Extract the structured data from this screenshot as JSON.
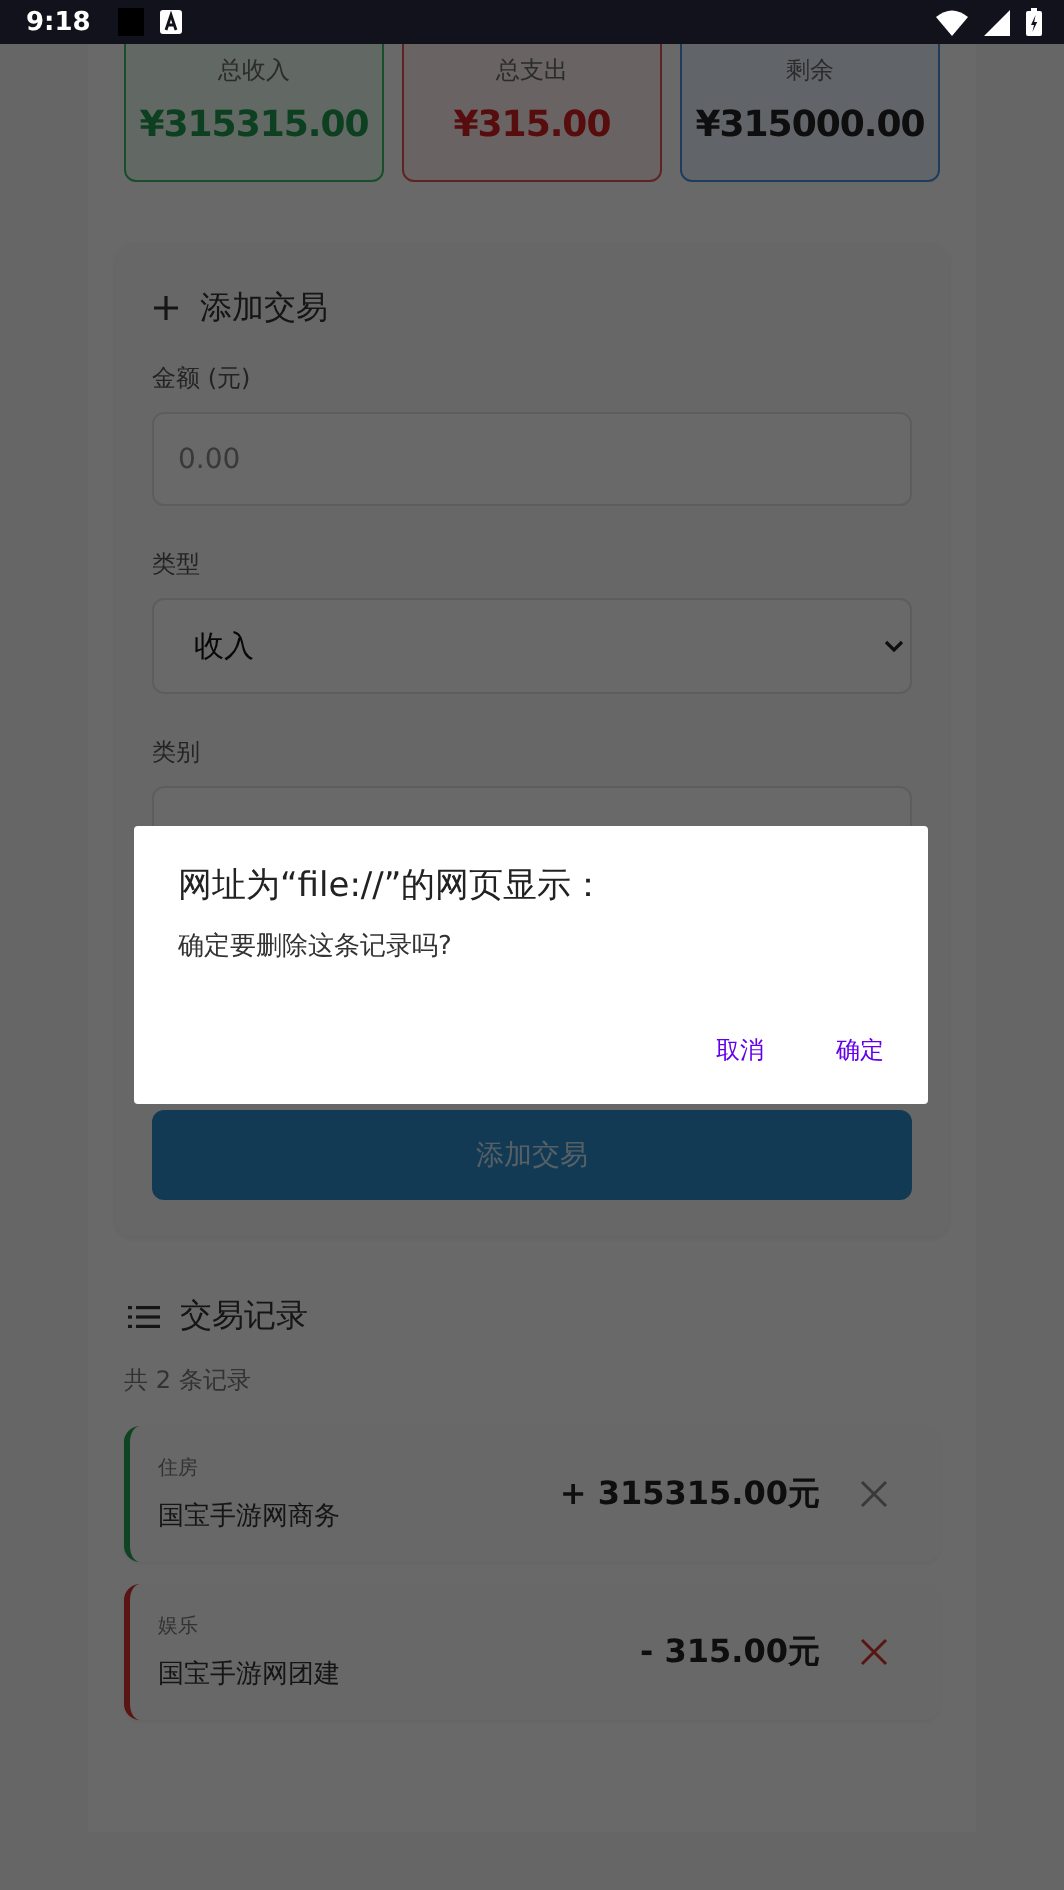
{
  "status_bar": {
    "time": "9:18"
  },
  "summary": [
    {
      "label": "总收入",
      "value": "¥315315.00",
      "kind": "income"
    },
    {
      "label": "总支出",
      "value": "¥315.00",
      "kind": "expense"
    },
    {
      "label": "剩余",
      "value": "¥315000.00",
      "kind": "balance"
    }
  ],
  "form": {
    "title": "添加交易",
    "fields": [
      {
        "label": "金额 (元)",
        "kind": "input",
        "placeholder": "0.00"
      },
      {
        "label": "类型",
        "kind": "select",
        "value": "收入"
      },
      {
        "label": "类别",
        "kind": "select"
      }
    ],
    "submit": "添加交易"
  },
  "records": {
    "title": "交易记录",
    "count": "共 2 条记录",
    "items": [
      {
        "category": "住房",
        "note": "国宝手游网商务",
        "amount": "+ 315315.00元",
        "kind": "income"
      },
      {
        "category": "娱乐",
        "note": "国宝手游网团建",
        "amount": "- 315.00元",
        "kind": "expense"
      }
    ]
  },
  "dialog": {
    "title": "网址为“file://”的网页显示：",
    "message": "确定要删除这条记录吗?",
    "buttons": [
      "取消",
      "确定"
    ]
  }
}
